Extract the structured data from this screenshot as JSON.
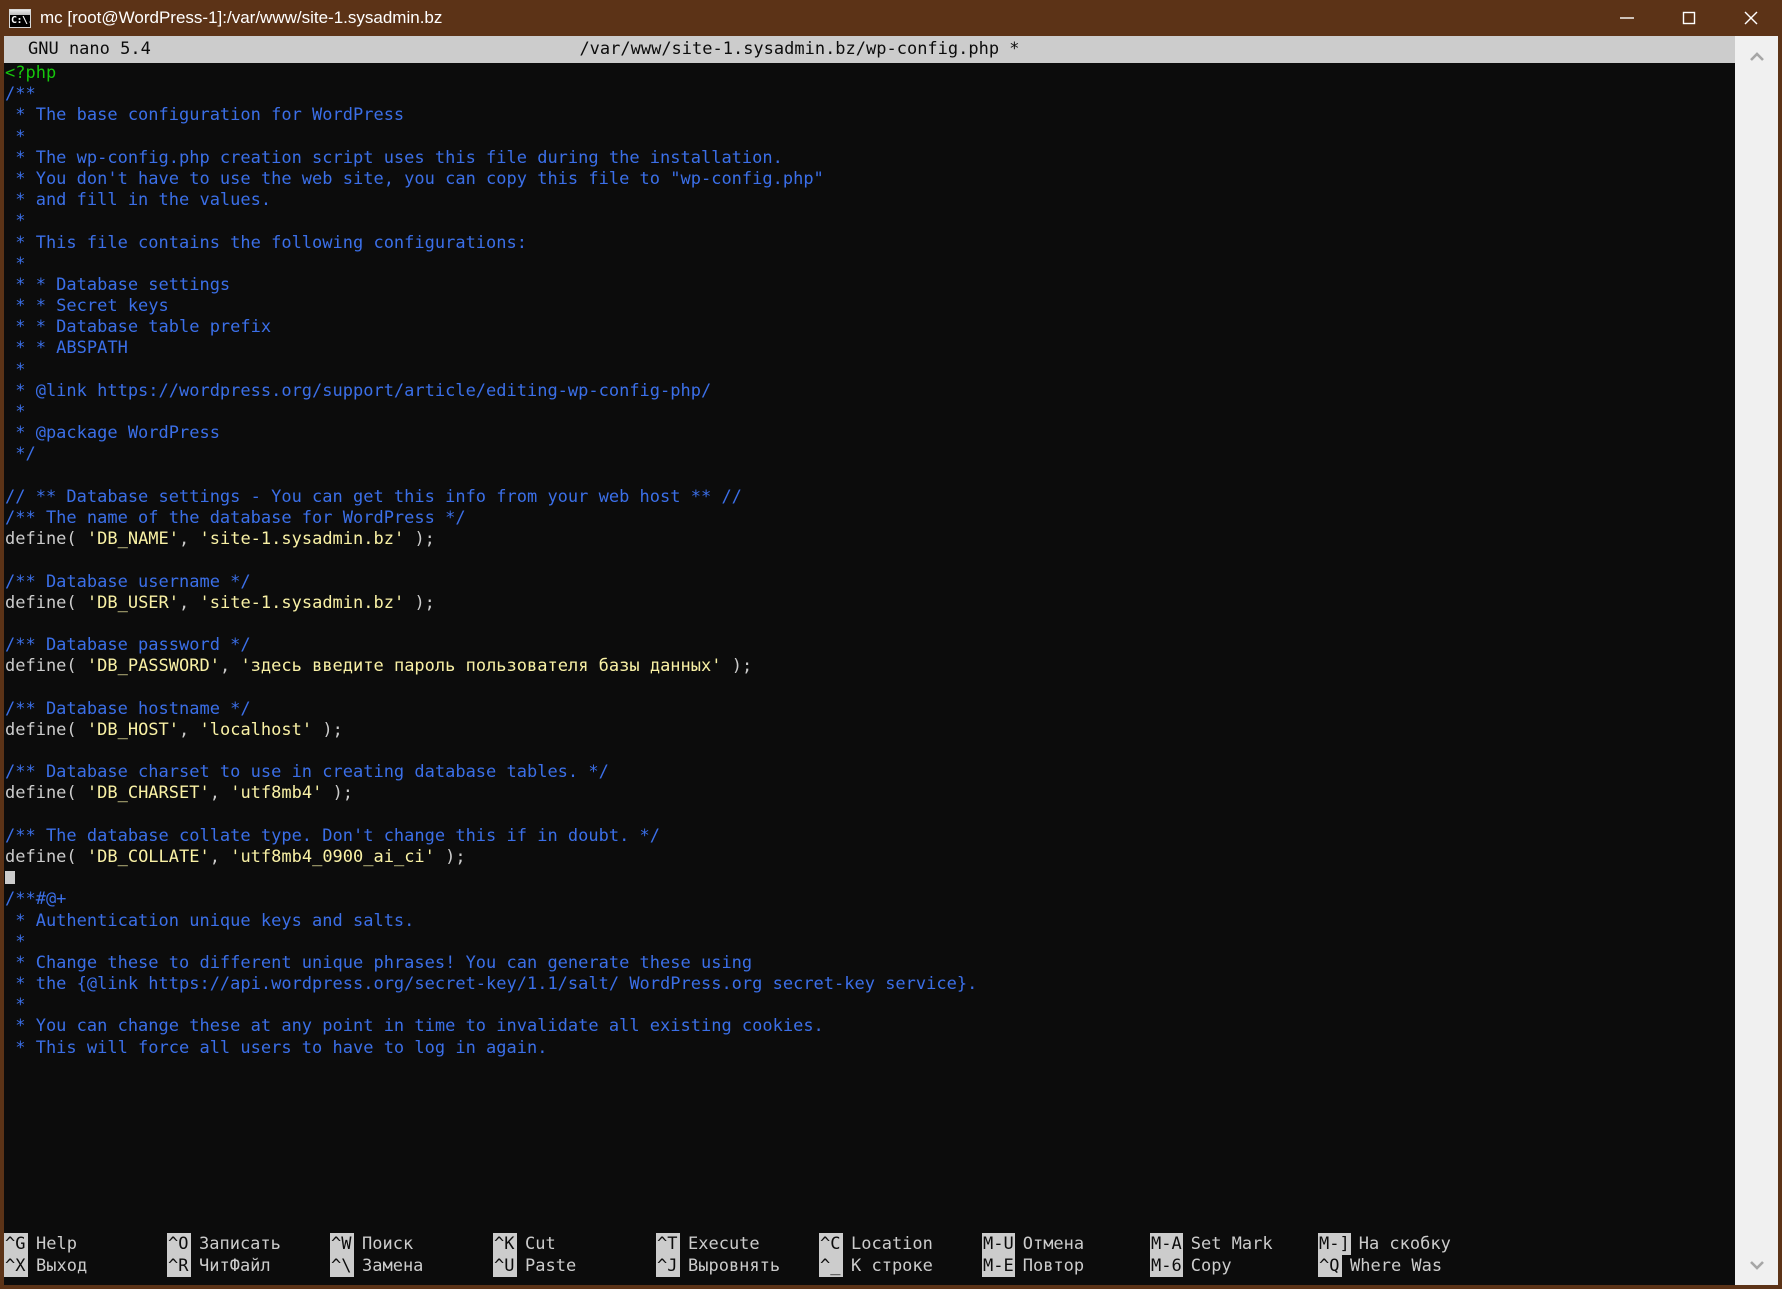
{
  "window": {
    "title": "mc [root@WordPress-1]:/var/www/site-1.sysadmin.bz",
    "icon": "console-icon",
    "icon_glyph": "C:\\.",
    "minimize_label": "—",
    "maximize_label": "□",
    "close_label": "✕",
    "titlebar_color": "#5c3317",
    "terminal_bg": "#0c0c0c"
  },
  "nano": {
    "version": "GNU nano 5.4",
    "file_path": "/var/www/site-1.sysadmin.bz/wp-config.php *",
    "header_bg": "#cccccc",
    "header_fg": "#0c0c0c"
  },
  "colors": {
    "comment": "#3b6fe8",
    "php_tag": "#16c60c",
    "string": "#f9f1a5",
    "plain": "#cccccc",
    "cursor": "#cccccc"
  },
  "code_lines": [
    {
      "segments": [
        {
          "text": "<?php",
          "style": "tag"
        }
      ]
    },
    {
      "segments": [
        {
          "text": "/**",
          "style": "comment"
        }
      ]
    },
    {
      "segments": [
        {
          "text": " * The base configuration for WordPress",
          "style": "comment"
        }
      ]
    },
    {
      "segments": [
        {
          "text": " *",
          "style": "comment"
        }
      ]
    },
    {
      "segments": [
        {
          "text": " * The wp-config.php creation script uses this file during the installation.",
          "style": "comment"
        }
      ]
    },
    {
      "segments": [
        {
          "text": " * You don't have to use the web site, you can copy this file to \"wp-config.php\"",
          "style": "comment"
        }
      ]
    },
    {
      "segments": [
        {
          "text": " * and fill in the values.",
          "style": "comment"
        }
      ]
    },
    {
      "segments": [
        {
          "text": " *",
          "style": "comment"
        }
      ]
    },
    {
      "segments": [
        {
          "text": " * This file contains the following configurations:",
          "style": "comment"
        }
      ]
    },
    {
      "segments": [
        {
          "text": " *",
          "style": "comment"
        }
      ]
    },
    {
      "segments": [
        {
          "text": " * * Database settings",
          "style": "comment"
        }
      ]
    },
    {
      "segments": [
        {
          "text": " * * Secret keys",
          "style": "comment"
        }
      ]
    },
    {
      "segments": [
        {
          "text": " * * Database table prefix",
          "style": "comment"
        }
      ]
    },
    {
      "segments": [
        {
          "text": " * * ABSPATH",
          "style": "comment"
        }
      ]
    },
    {
      "segments": [
        {
          "text": " *",
          "style": "comment"
        }
      ]
    },
    {
      "segments": [
        {
          "text": " * @link https://wordpress.org/support/article/editing-wp-config-php/",
          "style": "comment"
        }
      ]
    },
    {
      "segments": [
        {
          "text": " *",
          "style": "comment"
        }
      ]
    },
    {
      "segments": [
        {
          "text": " * @package WordPress",
          "style": "comment"
        }
      ]
    },
    {
      "segments": [
        {
          "text": " */",
          "style": "comment"
        }
      ]
    },
    {
      "segments": []
    },
    {
      "segments": [
        {
          "text": "// ** Database settings - You can get this info from your web host ** //",
          "style": "comment"
        }
      ]
    },
    {
      "segments": [
        {
          "text": "/** The name of the database for WordPress */",
          "style": "comment"
        }
      ]
    },
    {
      "segments": [
        {
          "text": "define( ",
          "style": "plain"
        },
        {
          "text": "'DB_NAME'",
          "style": "string"
        },
        {
          "text": ", ",
          "style": "plain"
        },
        {
          "text": "'site-1.sysadmin.bz'",
          "style": "string"
        },
        {
          "text": " );",
          "style": "plain"
        }
      ]
    },
    {
      "segments": []
    },
    {
      "segments": [
        {
          "text": "/** Database username */",
          "style": "comment"
        }
      ]
    },
    {
      "segments": [
        {
          "text": "define( ",
          "style": "plain"
        },
        {
          "text": "'DB_USER'",
          "style": "string"
        },
        {
          "text": ", ",
          "style": "plain"
        },
        {
          "text": "'site-1.sysadmin.bz'",
          "style": "string"
        },
        {
          "text": " );",
          "style": "plain"
        }
      ]
    },
    {
      "segments": []
    },
    {
      "segments": [
        {
          "text": "/** Database password */",
          "style": "comment"
        }
      ]
    },
    {
      "segments": [
        {
          "text": "define( ",
          "style": "plain"
        },
        {
          "text": "'DB_PASSWORD'",
          "style": "string"
        },
        {
          "text": ", ",
          "style": "plain"
        },
        {
          "text": "'здесь введите пароль пользователя базы данных'",
          "style": "string"
        },
        {
          "text": " );",
          "style": "plain"
        }
      ]
    },
    {
      "segments": []
    },
    {
      "segments": [
        {
          "text": "/** Database hostname */",
          "style": "comment"
        }
      ]
    },
    {
      "segments": [
        {
          "text": "define( ",
          "style": "plain"
        },
        {
          "text": "'DB_HOST'",
          "style": "string"
        },
        {
          "text": ", ",
          "style": "plain"
        },
        {
          "text": "'localhost'",
          "style": "string"
        },
        {
          "text": " );",
          "style": "plain"
        }
      ]
    },
    {
      "segments": []
    },
    {
      "segments": [
        {
          "text": "/** Database charset to use in creating database tables. */",
          "style": "comment"
        }
      ]
    },
    {
      "segments": [
        {
          "text": "define( ",
          "style": "plain"
        },
        {
          "text": "'DB_CHARSET'",
          "style": "string"
        },
        {
          "text": ", ",
          "style": "plain"
        },
        {
          "text": "'utf8mb4'",
          "style": "string"
        },
        {
          "text": " );",
          "style": "plain"
        }
      ]
    },
    {
      "segments": []
    },
    {
      "segments": [
        {
          "text": "/** The database collate type. Don't change this if in doubt. */",
          "style": "comment"
        }
      ]
    },
    {
      "segments": [
        {
          "text": "define( ",
          "style": "plain"
        },
        {
          "text": "'DB_COLLATE'",
          "style": "string"
        },
        {
          "text": ", ",
          "style": "plain"
        },
        {
          "text": "'utf8mb4_0900_ai_ci'",
          "style": "string"
        },
        {
          "text": " );",
          "style": "plain"
        }
      ]
    },
    {
      "segments": [],
      "cursor": true
    },
    {
      "segments": [
        {
          "text": "/**#@+",
          "style": "comment"
        }
      ]
    },
    {
      "segments": [
        {
          "text": " * Authentication unique keys and salts.",
          "style": "comment"
        }
      ]
    },
    {
      "segments": [
        {
          "text": " *",
          "style": "comment"
        }
      ]
    },
    {
      "segments": [
        {
          "text": " * Change these to different unique phrases! You can generate these using",
          "style": "comment"
        }
      ]
    },
    {
      "segments": [
        {
          "text": " * the {@link https://api.wordpress.org/secret-key/1.1/salt/ WordPress.org secret-key service}.",
          "style": "comment"
        }
      ]
    },
    {
      "segments": [
        {
          "text": " *",
          "style": "comment"
        }
      ]
    },
    {
      "segments": [
        {
          "text": " * You can change these at any point in time to invalidate all existing cookies.",
          "style": "comment"
        }
      ]
    },
    {
      "segments": [
        {
          "text": " * This will force all users to have to log in again.",
          "style": "comment"
        }
      ]
    }
  ],
  "shortcuts": [
    [
      {
        "key": "^G",
        "label": "Help"
      },
      {
        "key": "^X",
        "label": "Выход"
      }
    ],
    [
      {
        "key": "^O",
        "label": "Записать"
      },
      {
        "key": "^R",
        "label": "ЧитФайл"
      }
    ],
    [
      {
        "key": "^W",
        "label": "Поиск"
      },
      {
        "key": "^\\",
        "label": "Замена"
      }
    ],
    [
      {
        "key": "^K",
        "label": "Cut"
      },
      {
        "key": "^U",
        "label": "Paste"
      }
    ],
    [
      {
        "key": "^T",
        "label": "Execute"
      },
      {
        "key": "^J",
        "label": "Выровнять"
      }
    ],
    [
      {
        "key": "^C",
        "label": "Location"
      },
      {
        "key": "^_",
        "label": "К строке"
      }
    ],
    [
      {
        "key": "M-U",
        "label": "Отмена"
      },
      {
        "key": "M-E",
        "label": "Повтор"
      }
    ],
    [
      {
        "key": "M-A",
        "label": "Set Mark"
      },
      {
        "key": "M-6",
        "label": "Copy"
      }
    ],
    [
      {
        "key": "M-]",
        "label": "На скобку"
      },
      {
        "key": "^Q",
        "label": "Where Was"
      }
    ]
  ],
  "scrollbar": {
    "up_arrow": "chevron-up",
    "down_arrow": "chevron-down"
  }
}
